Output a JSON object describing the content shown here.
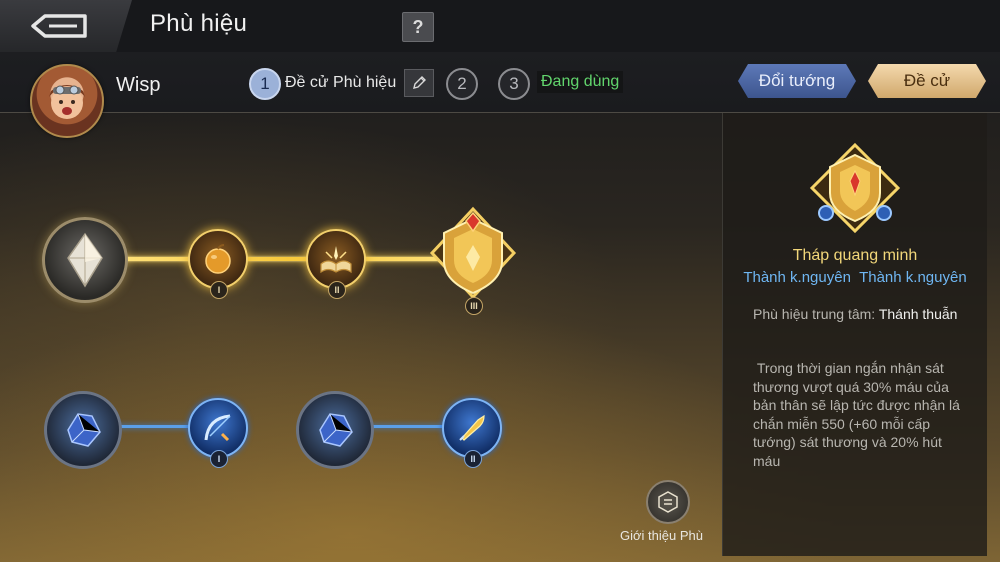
{
  "header": {
    "title": "Phù hiệu",
    "help_label": "?"
  },
  "hero": {
    "name": "Wisp"
  },
  "steps": [
    {
      "number": "1",
      "label": "Đề cử Phù hiệu",
      "active": true
    },
    {
      "number": "2",
      "label": "",
      "active": false
    },
    {
      "number": "3",
      "label": "Đang dùng",
      "active": false
    }
  ],
  "buttons": {
    "swap_hero": "Đổi tướng",
    "suggest": "Đề cử"
  },
  "tree": {
    "gold_tiers": [
      "I",
      "II",
      "III"
    ],
    "blue_branch_1_tier": "I",
    "blue_branch_2_tier": "II"
  },
  "intro": {
    "label": "Giới thiệu Phù"
  },
  "detail": {
    "title": "Tháp quang minh",
    "tag_1": "Thành k.nguyên",
    "tag_2": "Thành k.nguyên",
    "core_label": "Phù hiệu trung tâm:",
    "core_value": "Thánh thuẫn",
    "description": " Trong thời gian ngắn nhận sát thương vượt quá 30% máu của bản thân sẽ lập tức được nhận lá chắn miễn 550 (+60 mỗi cấp tướng) sát thương và 20% hút máu"
  },
  "colors": {
    "gold_line": "#f8c93b",
    "blue_line": "#5b9fe8",
    "title_gold": "#f2d77a",
    "tag_blue": "#6fb6f2",
    "active_green": "#62d56d"
  }
}
